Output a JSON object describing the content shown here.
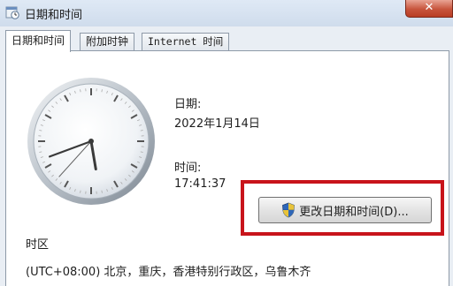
{
  "window": {
    "title": "日期和时间",
    "close_label": "✕"
  },
  "tabs": [
    {
      "label": "日期和时间",
      "active": true
    },
    {
      "label": "附加时钟",
      "active": false
    },
    {
      "label": "Internet 时间",
      "active": false
    }
  ],
  "date_time": {
    "date_label": "日期:",
    "date_value": "2022年1月14日",
    "time_label": "时间:",
    "time_value": "17:41:37",
    "change_button": "更改日期和时间(D)..."
  },
  "timezone": {
    "section_label": "时区",
    "value": "(UTC+08:00) 北京，重庆，香港特别行政区，乌鲁木齐"
  },
  "clock": {
    "hour": 17,
    "minute": 41,
    "second": 37
  },
  "colors": {
    "highlight": "#c8141b"
  },
  "icons": {
    "title": "calendar-clock-icon",
    "button": "uac-shield-icon"
  }
}
